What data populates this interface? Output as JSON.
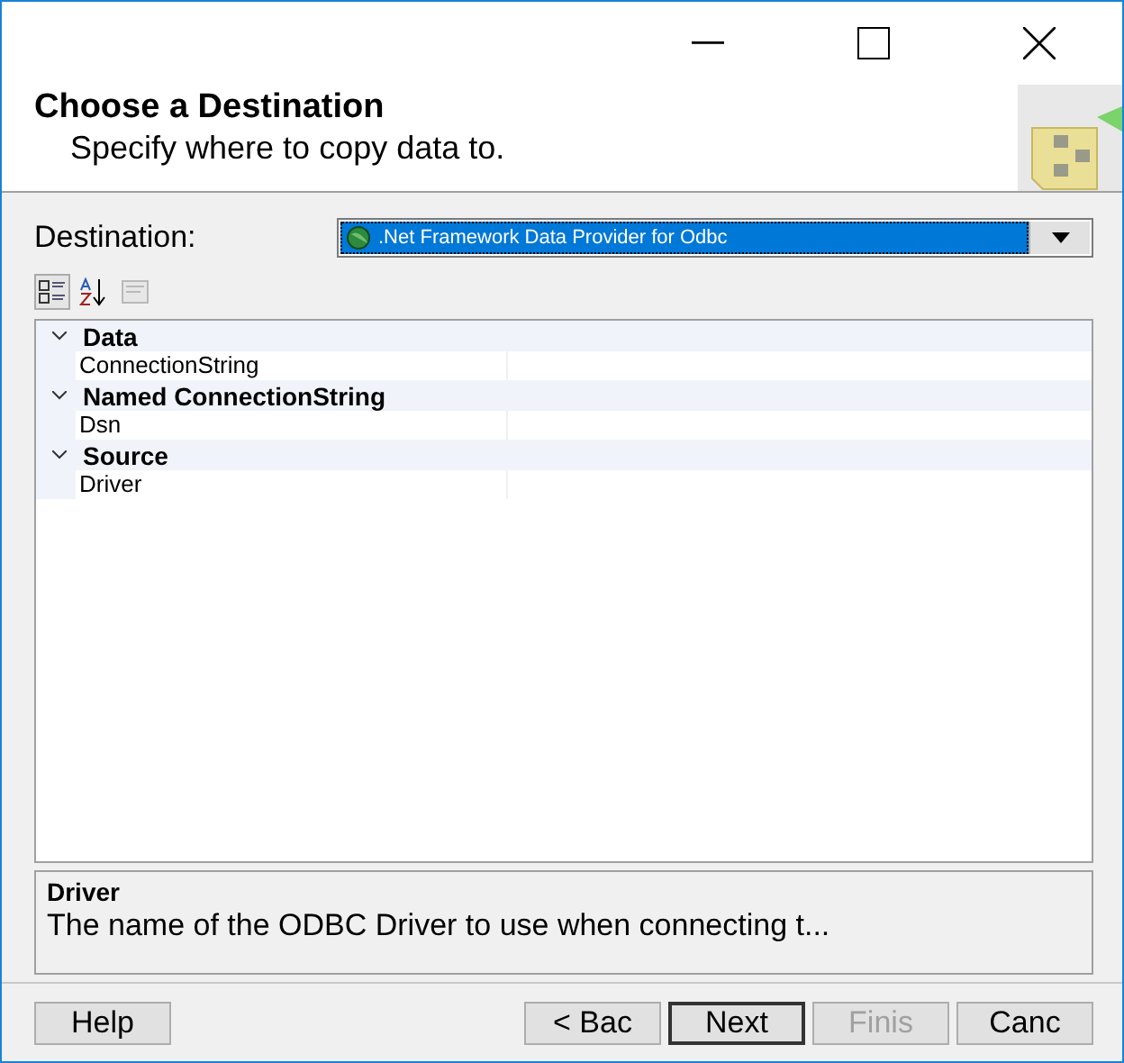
{
  "header": {
    "title": "Choose a Destination",
    "subtitle": "Specify where to copy data to."
  },
  "destination": {
    "label": "Destination:",
    "value": ".Net Framework Data Provider for Odbc"
  },
  "toolbar": [
    {
      "kind": "categorized",
      "selected": true,
      "disabled": false
    },
    {
      "kind": "alphabetical",
      "selected": false,
      "disabled": false
    },
    {
      "kind": "pages",
      "selected": false,
      "disabled": true
    }
  ],
  "properties": [
    {
      "category": "Data",
      "expanded": true,
      "children": [
        {
          "name": "ConnectionString"
        }
      ]
    },
    {
      "category": "Named ConnectionString",
      "expanded": true,
      "children": [
        {
          "name": "Dsn"
        }
      ]
    },
    {
      "category": "Source",
      "expanded": true,
      "children": [
        {
          "name": "Driver"
        }
      ]
    }
  ],
  "description": {
    "title": "Driver",
    "text": "The name of the ODBC Driver to use when connecting t..."
  },
  "buttons": [
    {
      "label": "Help",
      "disabled": false,
      "default": false
    },
    {
      "label": "< Bac",
      "disabled": false,
      "default": false
    },
    {
      "label": "Next",
      "disabled": false,
      "default": true
    },
    {
      "label": "Finis",
      "disabled": true,
      "default": false
    },
    {
      "label": "Canc",
      "disabled": false,
      "default": false
    }
  ]
}
